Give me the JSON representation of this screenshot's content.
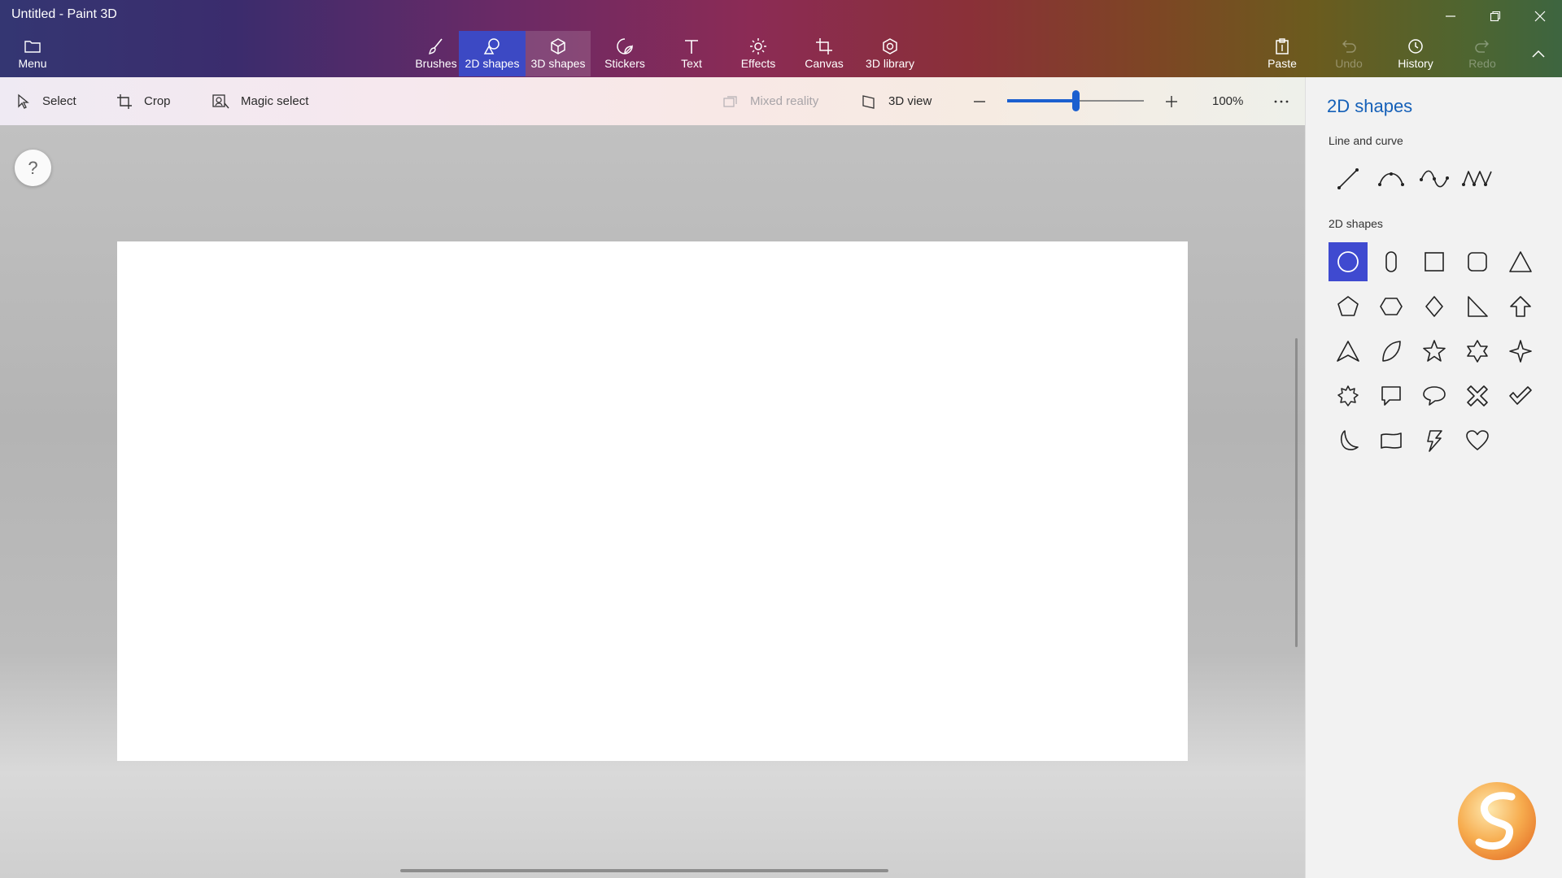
{
  "window": {
    "title": "Untitled - Paint 3D"
  },
  "menu": {
    "label": "Menu"
  },
  "ribbon": {
    "tabs": [
      {
        "label": "Brushes"
      },
      {
        "label": "2D shapes"
      },
      {
        "label": "3D shapes"
      },
      {
        "label": "Stickers"
      },
      {
        "label": "Text"
      },
      {
        "label": "Effects"
      },
      {
        "label": "Canvas"
      },
      {
        "label": "3D library"
      }
    ],
    "right": [
      {
        "label": "Paste"
      },
      {
        "label": "Undo"
      },
      {
        "label": "History"
      },
      {
        "label": "Redo"
      }
    ]
  },
  "toolbar": {
    "select": "Select",
    "crop": "Crop",
    "magic_select": "Magic select",
    "mixed_reality": "Mixed reality",
    "view_3d": "3D view",
    "zoom": "100%",
    "zoom_fraction": 0.5
  },
  "panel": {
    "title": "2D shapes",
    "line_section": "Line and curve",
    "shape_section": "2D shapes"
  },
  "colors": {
    "accent": "#3f4ad0",
    "panel_title": "#1560b8"
  }
}
